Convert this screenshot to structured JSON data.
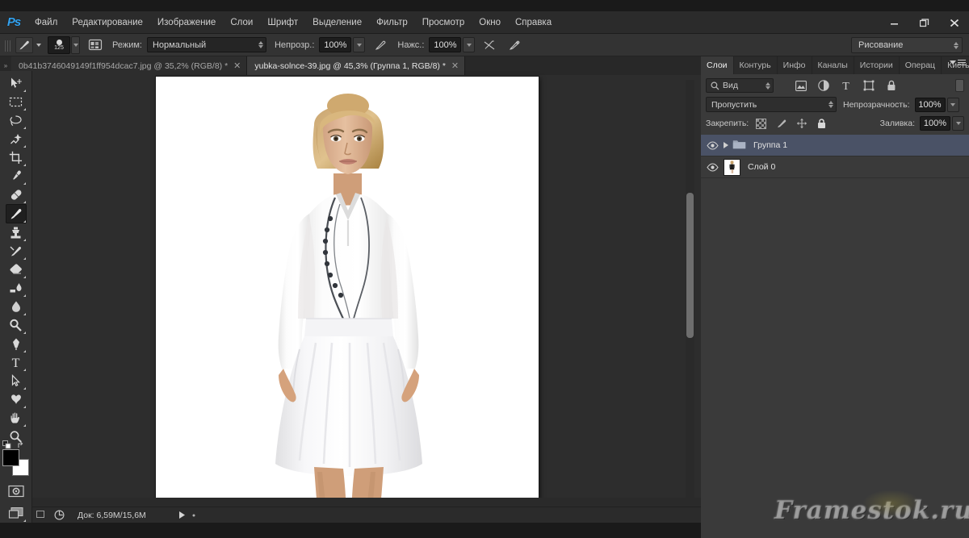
{
  "app": {
    "name": "Adobe Photoshop",
    "logo_text": "Ps"
  },
  "menubar": {
    "items": [
      {
        "label": "Файл"
      },
      {
        "label": "Редактирование"
      },
      {
        "label": "Изображение"
      },
      {
        "label": "Слои"
      },
      {
        "label": "Шрифт"
      },
      {
        "label": "Выделение"
      },
      {
        "label": "Фильтр"
      },
      {
        "label": "Просмотр"
      },
      {
        "label": "Окно"
      },
      {
        "label": "Справка"
      }
    ]
  },
  "window_controls": {
    "minimize": "—",
    "restore": "❐",
    "close": "✕"
  },
  "options_bar": {
    "brush_size": "125",
    "mode_label": "Режим:",
    "mode_value": "Нормальный",
    "opacity_label": "Непрозр.:",
    "opacity_value": "100%",
    "flow_label": "Нажс.:",
    "flow_value": "100%",
    "workspace": "Рисование"
  },
  "tabs": [
    {
      "label": "0b41b3746049149f1ff954dcac7.jpg @ 35,2% (RGB/8) *",
      "active": false,
      "close": "✕"
    },
    {
      "label": "yubka-solnce-39.jpg @ 45,3% (Группа 1, RGB/8) *",
      "active": true,
      "close": "✕"
    }
  ],
  "toolbar": {
    "tools": [
      {
        "name": "move-tool",
        "active": false,
        "has_submenu": true
      },
      {
        "name": "rectangular-marquee-tool",
        "active": false,
        "has_submenu": true
      },
      {
        "name": "lasso-tool",
        "active": false,
        "has_submenu": true
      },
      {
        "name": "quick-selection-tool",
        "active": false,
        "has_submenu": true
      },
      {
        "name": "crop-tool",
        "active": false,
        "has_submenu": true
      },
      {
        "name": "eyedropper-tool",
        "active": false,
        "has_submenu": true
      },
      {
        "name": "spot-healing-brush-tool",
        "active": false,
        "has_submenu": true
      },
      {
        "name": "brush-tool",
        "active": true,
        "has_submenu": true
      },
      {
        "name": "clone-stamp-tool",
        "active": false,
        "has_submenu": true
      },
      {
        "name": "history-brush-tool",
        "active": false,
        "has_submenu": true
      },
      {
        "name": "eraser-tool",
        "active": false,
        "has_submenu": true
      },
      {
        "name": "gradient-tool",
        "active": false,
        "has_submenu": true
      },
      {
        "name": "blur-tool",
        "active": false,
        "has_submenu": true
      },
      {
        "name": "dodge-tool",
        "active": false,
        "has_submenu": true
      },
      {
        "name": "pen-tool",
        "active": false,
        "has_submenu": true
      },
      {
        "name": "horizontal-type-tool",
        "active": false,
        "has_submenu": true
      },
      {
        "name": "path-selection-tool",
        "active": false,
        "has_submenu": true
      },
      {
        "name": "custom-shape-tool",
        "active": false,
        "has_submenu": true
      },
      {
        "name": "hand-tool",
        "active": false,
        "has_submenu": true
      },
      {
        "name": "zoom-tool",
        "active": false,
        "has_submenu": false
      }
    ],
    "foreground_color": "#000000",
    "background_color": "#ffffff"
  },
  "layers_panel": {
    "tabs": [
      {
        "label": "Слои",
        "active": true
      },
      {
        "label": "Контурь",
        "active": false
      },
      {
        "label": "Инфо",
        "active": false
      },
      {
        "label": "Каналы",
        "active": false
      },
      {
        "label": "Истории",
        "active": false
      },
      {
        "label": "Операц",
        "active": false
      },
      {
        "label": "Кисть",
        "active": false
      }
    ],
    "filter_placeholder": "Вид",
    "blend_mode": "Пропустить",
    "opacity_label": "Непрозрачность:",
    "opacity_value": "100%",
    "lock_label": "Закрепить:",
    "fill_label": "Заливка:",
    "fill_value": "100%",
    "layers": [
      {
        "name": "Группа 1",
        "type": "group",
        "selected": true,
        "visible": true
      },
      {
        "name": "Слой 0",
        "type": "image",
        "selected": false,
        "visible": true
      }
    ]
  },
  "status_bar": {
    "doc_info": "Док: 6,59M/15,6M"
  },
  "watermark": {
    "text": "Framestok.ru"
  },
  "colors": {
    "accent": "#34a3f0",
    "panel_bg": "#3a3a3a",
    "selected_layer": "#4a5266",
    "canvas_bg": "#2d2d2d"
  }
}
